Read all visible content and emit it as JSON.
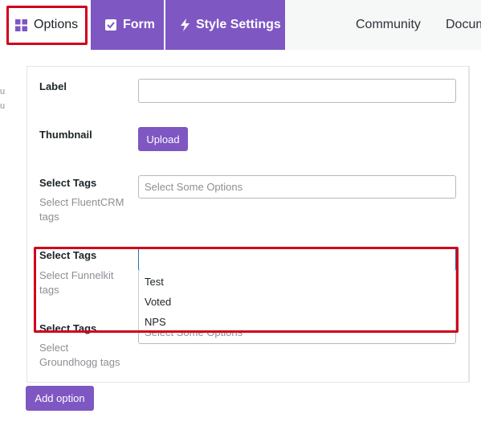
{
  "nav": {
    "options_label": "Options",
    "form_label": "Form",
    "style_label": "Style Settings",
    "community_label": "Community",
    "docs_label": "Docum"
  },
  "sidebar_stray": [
    "u",
    "u"
  ],
  "fields": {
    "label": {
      "title": "Label",
      "value": ""
    },
    "thumbnail": {
      "title": "Thumbnail",
      "upload_label": "Upload"
    },
    "fluentcrm": {
      "title": "Select Tags",
      "hint": "Select FluentCRM tags",
      "placeholder": "Select Some Options"
    },
    "funnelkit": {
      "title": "Select Tags",
      "hint": "Select Funnelkit tags",
      "value": ""
    },
    "groundhogg": {
      "title": "Select Tags",
      "hint": "Select Groundhogg tags",
      "placeholder": "Select Some Options"
    }
  },
  "funnelkit_options": [
    "Test",
    "Voted",
    "NPS"
  ],
  "add_option_label": "Add option",
  "colors": {
    "accent": "#7e57c2",
    "highlight": "#d0021b"
  }
}
